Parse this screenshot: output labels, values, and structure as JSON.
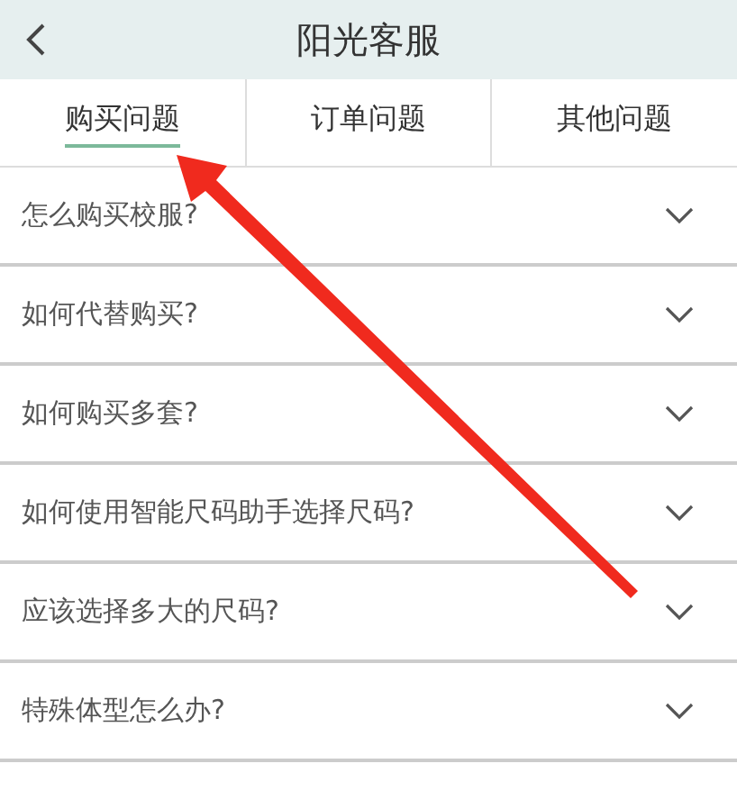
{
  "header": {
    "title": "阳光客服"
  },
  "tabs": [
    {
      "label": "购买问题",
      "selected": true
    },
    {
      "label": "订单问题",
      "selected": false
    },
    {
      "label": "其他问题",
      "selected": false
    }
  ],
  "questions": [
    {
      "text": "怎么购买校服?",
      "expanded": false
    },
    {
      "text": "如何代替购买?",
      "expanded": false
    },
    {
      "text": "如何购买多套?",
      "expanded": false
    },
    {
      "text": "如何使用智能尺码助手选择尺码?",
      "expanded": false
    },
    {
      "text": "应该选择多大的尺码?",
      "expanded": false
    },
    {
      "text": "特殊体型怎么办?",
      "expanded": false
    }
  ]
}
